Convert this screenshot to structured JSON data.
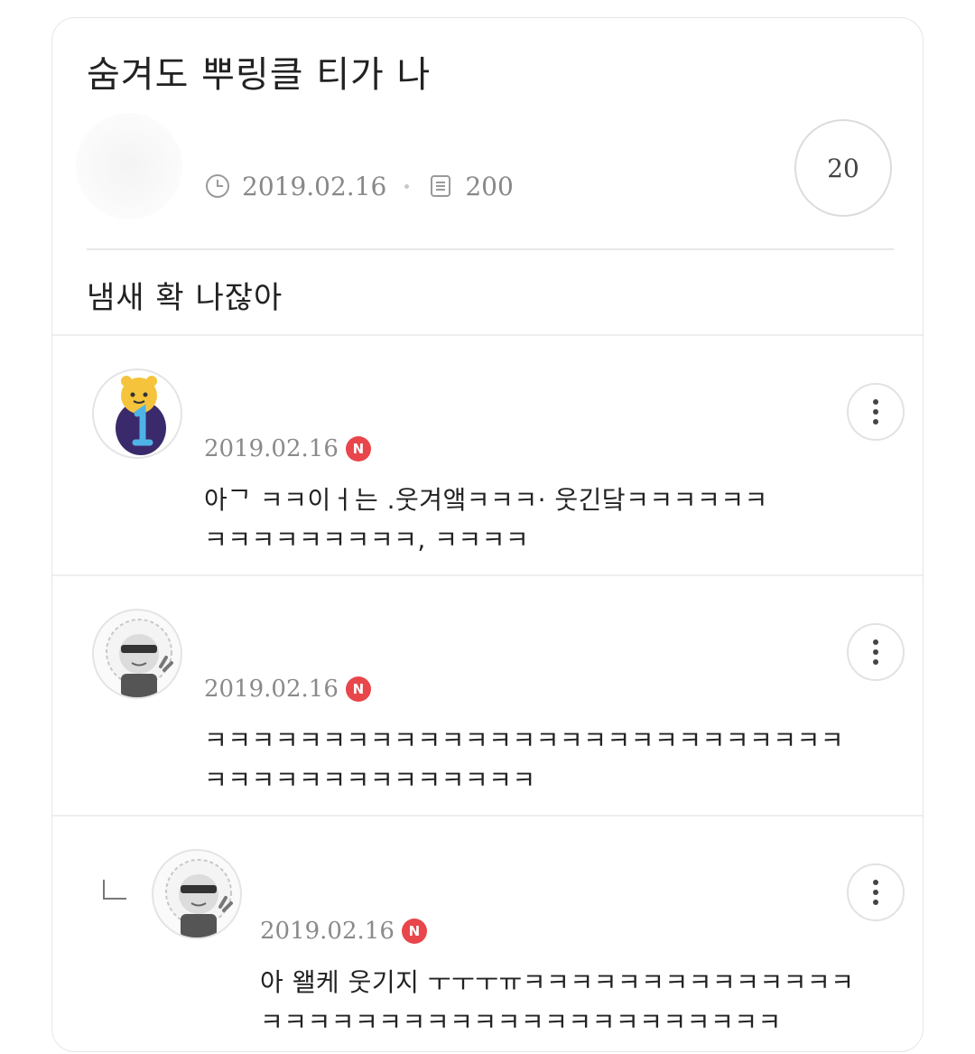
{
  "post": {
    "title": "숨겨도 뿌링클 티가 나",
    "date": "2019.02.16",
    "views": "200",
    "comment_count": "20",
    "body": "냄새 확 나잖아"
  },
  "icons": {
    "date": "clock-icon",
    "views": "document-icon",
    "more": "more-vertical-icon",
    "reply": "reply-arrow-icon",
    "new": "new-badge-icon"
  },
  "colors": {
    "new_badge": "#e8464b",
    "meta_text": "#888888",
    "border": "#e6e6e6"
  },
  "comments": [
    {
      "date": "2019.02.16",
      "badge": "N",
      "line1": "아ᄀ    ㅋㅋ이ㅓ는  .웃겨앸ㅋㅋㅋ·           웃긴닼ㅋㅋㅋㅋㅋㅋ",
      "line2": "ㅋㅋㅋㅋㅋㅋㅋㅋㅋ,      ㅋㅋㅋㅋ"
    },
    {
      "date": "2019.02.16",
      "badge": "N",
      "line1": "ㅋㅋㅋㅋㅋㅋㅋㅋㅋㅋㅋㅋㅋㅋㅋㅋㅋㅋㅋㅋㅋㅋㅋㅋㅋㅋㅋ",
      "line2": "ㅋㅋㅋㅋㅋㅋㅋㅋㅋㅋㅋㅋㅋㅋ"
    },
    {
      "date": "2019.02.16",
      "badge": "N",
      "line1": "아 왤케 웃기지 ㅜㅜㅜㅠㅋㅋㅋㅋㅋㅋㅋㅋㅋㅋㅋㅋㅋㅋ",
      "line2": "ㅋㅋㅋㅋㅋㅋㅋㅋㅋㅋㅋㅋㅋㅋㅋㅋㅋㅋㅋㅋㅋㅋ"
    }
  ]
}
